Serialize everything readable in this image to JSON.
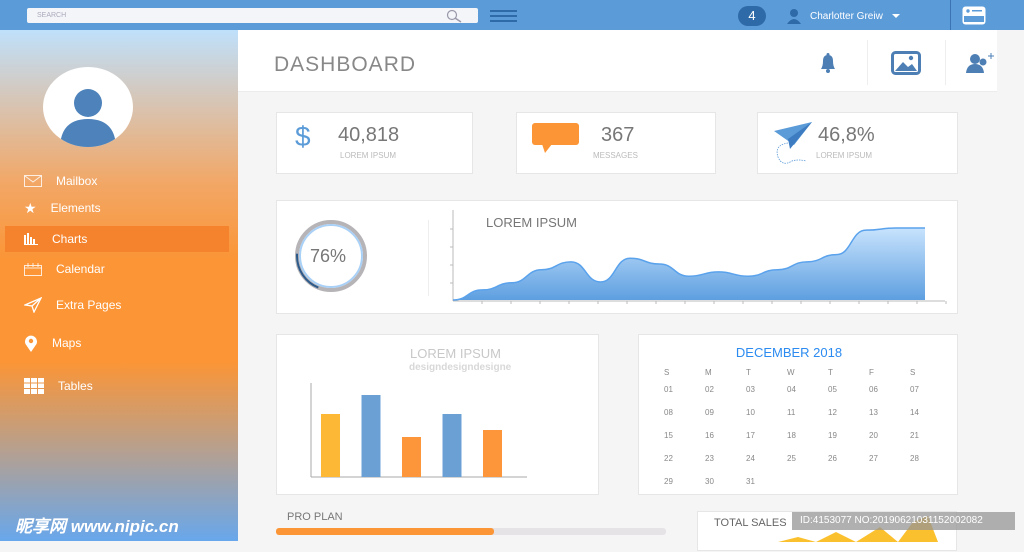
{
  "topbar": {
    "search_placeholder": "SEARCH",
    "notification_count": "4",
    "user_name": "Charlotter Greiw"
  },
  "sidebar": {
    "items": [
      {
        "label": "Mailbox",
        "icon": "mail-icon"
      },
      {
        "label": "Elements",
        "icon": "star-icon"
      },
      {
        "label": "Charts",
        "icon": "bar-chart-icon",
        "active": true
      },
      {
        "label": "Calendar",
        "icon": "calendar-icon"
      },
      {
        "label": "Extra Pages",
        "icon": "paper-plane-icon"
      },
      {
        "label": "Maps",
        "icon": "map-pin-icon"
      },
      {
        "label": "Tables",
        "icon": "grid-icon"
      }
    ]
  },
  "header": {
    "title": "DASHBOARD"
  },
  "stats": [
    {
      "value": "40,818",
      "label": "LOREM IPSUM",
      "icon": "dollar-icon"
    },
    {
      "value": "367",
      "label": "MESSAGES",
      "icon": "chat-bubble-icon"
    },
    {
      "value": "46,8%",
      "label": "LOREM IPSUM",
      "icon": "paper-plane-icon"
    }
  ],
  "progress_ring": {
    "label": "76%",
    "value": 76
  },
  "chart_data": [
    {
      "type": "area",
      "title": "LOREM IPSUM",
      "x": [
        0,
        1,
        2,
        3,
        4,
        5,
        6,
        7,
        8,
        9,
        10,
        11,
        12,
        13,
        14,
        15,
        16
      ],
      "y": [
        0,
        14,
        24,
        42,
        53,
        25,
        58,
        50,
        33,
        39,
        33,
        42,
        53,
        63,
        97,
        100,
        100
      ],
      "color": "#5aa2ec",
      "grid": false
    },
    {
      "type": "bar",
      "title": "LOREM IPSUM",
      "subtitle": "designdesigndesigne",
      "values": [
        63,
        82,
        40,
        63,
        47
      ],
      "colors": [
        "#fdb935",
        "#6aa0d4",
        "#fd953a",
        "#6aa0d4",
        "#fd953a"
      ],
      "grid": false
    }
  ],
  "calendar": {
    "title": "DECEMBER 2018",
    "weekdays": [
      "S",
      "M",
      "T",
      "W",
      "T",
      "F",
      "S"
    ],
    "days": [
      "01",
      "02",
      "03",
      "04",
      "05",
      "06",
      "07",
      "08",
      "09",
      "10",
      "11",
      "12",
      "13",
      "14",
      "15",
      "16",
      "17",
      "18",
      "19",
      "20",
      "21",
      "22",
      "23",
      "24",
      "25",
      "26",
      "27",
      "28",
      "29",
      "30",
      "31"
    ]
  },
  "pro_plan": {
    "label": "PRO PLAN",
    "progress": 56
  },
  "total_sales": {
    "label": "TOTAL SALES"
  },
  "watermark": {
    "site": "昵享网 www.nipic.cn",
    "id": "ID:4153077 NO:20190621031152002082"
  },
  "colors": {
    "accent_blue": "#5b9bd8",
    "accent_orange": "#fb9536"
  }
}
